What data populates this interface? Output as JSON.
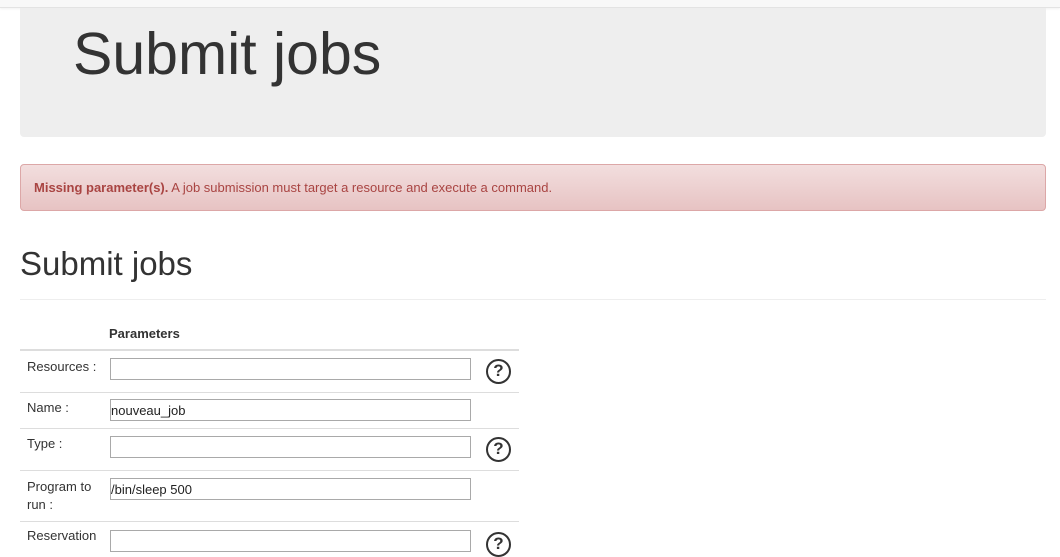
{
  "jumbotron": {
    "title": "Submit jobs"
  },
  "alert": {
    "strong": "Missing parameter(s).",
    "message": " A job submission must target a resource and execute a command."
  },
  "section": {
    "title": "Submit jobs"
  },
  "params": {
    "header": "Parameters",
    "rows": [
      {
        "label": "Resources :",
        "value": "",
        "help": "?"
      },
      {
        "label": "Name :",
        "value": "nouveau_job"
      },
      {
        "label": "Type :",
        "value": "",
        "help": "?"
      },
      {
        "label": "Program to run :",
        "value": "/bin/sleep 500"
      },
      {
        "label": "Reservation",
        "value": "",
        "help": "?"
      }
    ]
  },
  "colors": {
    "alert_text": "#a94442",
    "alert_bg": "#f2dede",
    "jumbotron_bg": "#eeeeee"
  }
}
